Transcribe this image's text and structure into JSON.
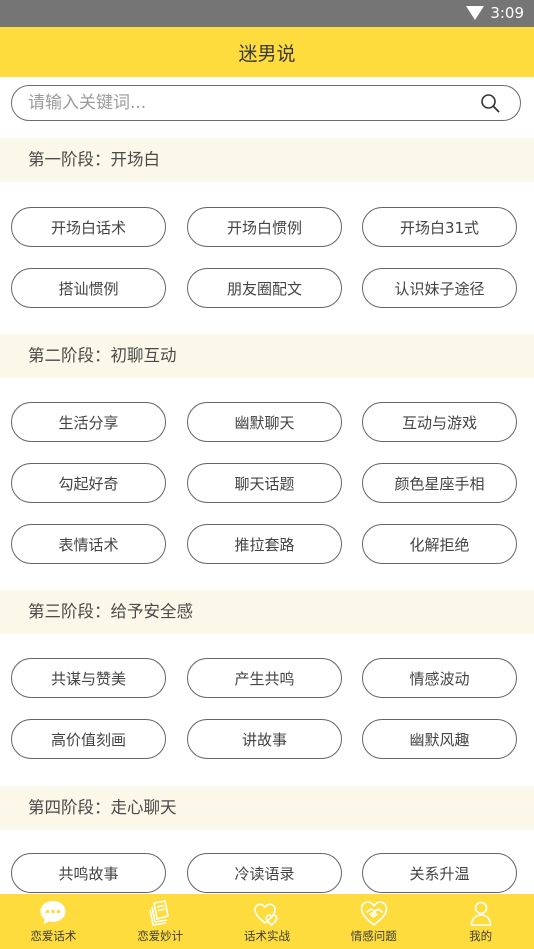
{
  "status_bar": {
    "time": "3:09"
  },
  "header": {
    "title": "迷男说"
  },
  "search": {
    "placeholder": "请输入关键词..."
  },
  "sections": [
    {
      "title": "第一阶段：开场白",
      "items": [
        "开场白话术",
        "开场白惯例",
        "开场白31式",
        "搭讪惯例",
        "朋友圈配文",
        "认识妹子途径"
      ]
    },
    {
      "title": "第二阶段：初聊互动",
      "items": [
        "生活分享",
        "幽默聊天",
        "互动与游戏",
        "勾起好奇",
        "聊天话题",
        "颜色星座手相",
        "表情话术",
        "推拉套路",
        "化解拒绝"
      ]
    },
    {
      "title": "第三阶段：给予安全感",
      "items": [
        "共谋与赞美",
        "产生共鸣",
        "情感波动",
        "高价值刻画",
        "讲故事",
        "幽默风趣"
      ]
    },
    {
      "title": "第四阶段：走心聊天",
      "items": [
        "共鸣故事",
        "冷读语录",
        "关系升温"
      ]
    }
  ],
  "tabs": [
    {
      "label": "恋爱话术",
      "icon": "chat-bubble-icon",
      "active": true
    },
    {
      "label": "恋爱妙计",
      "icon": "book-icon",
      "active": false
    },
    {
      "label": "话术实战",
      "icon": "hearts-icon",
      "active": false
    },
    {
      "label": "情感问题",
      "icon": "handshake-icon",
      "active": false
    },
    {
      "label": "我的",
      "icon": "user-icon",
      "active": false
    }
  ],
  "colors": {
    "accent": "#fedc3d",
    "section_bg": "#fbf7e9",
    "status_bar": "#757575"
  }
}
